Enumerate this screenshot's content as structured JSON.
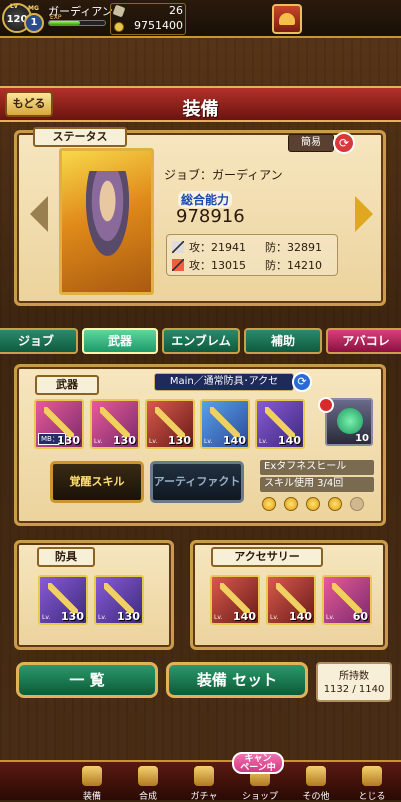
{
  "player": {
    "level_tag": "Lv",
    "level": "120",
    "mg_tag": "MG",
    "mg": "1",
    "name": "ガーディアン",
    "exp_tag": "EXP",
    "exp_progress": 0.55,
    "stamina": "26",
    "gold": "9751400"
  },
  "header": {
    "title": "装備",
    "back_label": "もどる"
  },
  "status": {
    "section_label": "ステータス",
    "simple_label": "簡易",
    "job_line": "ジョブ：ガーディアン",
    "power_label": "総合能力",
    "power_value": "978916",
    "physical": {
      "atk": "攻：21941",
      "def": "防：32891"
    },
    "magic": {
      "atk": "攻：13015",
      "def": "防：14210"
    }
  },
  "tabs": [
    {
      "label": "ジョブ",
      "active": false
    },
    {
      "label": "武器",
      "active": true
    },
    {
      "label": "エンブレム",
      "active": false
    },
    {
      "label": "補助",
      "active": false
    },
    {
      "label": "アバコレ",
      "active": false
    }
  ],
  "weapons": {
    "section_label": "武器",
    "mode_label": "Main／通常防具･アクセ",
    "mb_tag": "MB：2",
    "lv_tag": "Lv.",
    "items": [
      {
        "level": "130",
        "rarity": "pink"
      },
      {
        "level": "130",
        "rarity": "pink"
      },
      {
        "level": "130",
        "rarity": "pink"
      },
      {
        "level": "140",
        "rarity": "blue"
      },
      {
        "level": "140",
        "rarity": "purple"
      }
    ],
    "potion_count": "10",
    "awaken_label": "覚醒スキル",
    "artifact_label": "アーティファクト",
    "skill_name": "Exタフネスヒール",
    "skill_usage": "スキル使用 3/4回",
    "skill_stars_filled": 4,
    "skill_stars_total": 5
  },
  "armor": {
    "section_label": "防具",
    "items": [
      {
        "level": "130"
      },
      {
        "level": "130"
      }
    ]
  },
  "accessories": {
    "section_label": "アクセサリー",
    "items": [
      {
        "level": "140"
      },
      {
        "level": "140"
      },
      {
        "level": "60"
      }
    ]
  },
  "actions": {
    "list_label": "一 覧",
    "set_label": "装備 セット",
    "count_title": "所持数",
    "count_value": "1132 / 1140"
  },
  "nav": [
    {
      "label": "装備"
    },
    {
      "label": "合成"
    },
    {
      "label": "ガチャ"
    },
    {
      "label": "ショップ"
    },
    {
      "label": "その他"
    },
    {
      "label": "とじる"
    }
  ],
  "campaign_label": "キャン\nペーン中"
}
